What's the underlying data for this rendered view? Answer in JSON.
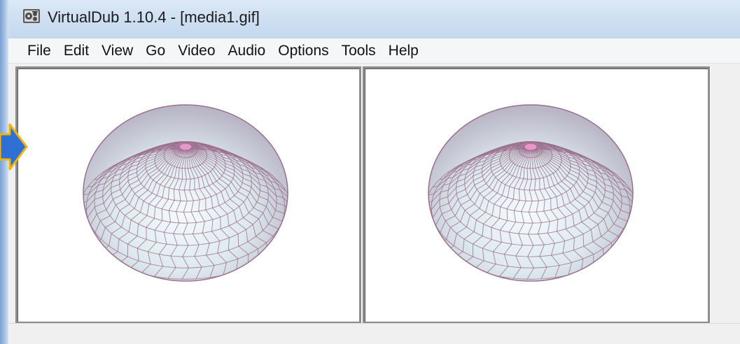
{
  "window": {
    "title": "VirtualDub 1.10.4 - [media1.gif]",
    "app_icon": "film-reel-icon"
  },
  "menu": {
    "items": [
      {
        "id": "file",
        "label": "File"
      },
      {
        "id": "edit",
        "label": "Edit"
      },
      {
        "id": "view",
        "label": "View"
      },
      {
        "id": "go",
        "label": "Go"
      },
      {
        "id": "video",
        "label": "Video"
      },
      {
        "id": "audio",
        "label": "Audio"
      },
      {
        "id": "options",
        "label": "Options"
      },
      {
        "id": "tools",
        "label": "Tools"
      },
      {
        "id": "help",
        "label": "Help"
      }
    ]
  },
  "panes": {
    "input": {
      "content": "hexagon-sphere-image"
    },
    "output": {
      "content": "hexagon-sphere-image"
    }
  },
  "overlay": {
    "arrow_icon": "arrow-right-icon",
    "arrow_color": "#2f6fd6",
    "arrow_outline": "#f2b400"
  },
  "colors": {
    "sphere_fill": "#dde9ee",
    "sphere_edge": "#9a6f8c",
    "pane_border": "#8c8c8c",
    "titlebar": "#cfe0f2"
  }
}
